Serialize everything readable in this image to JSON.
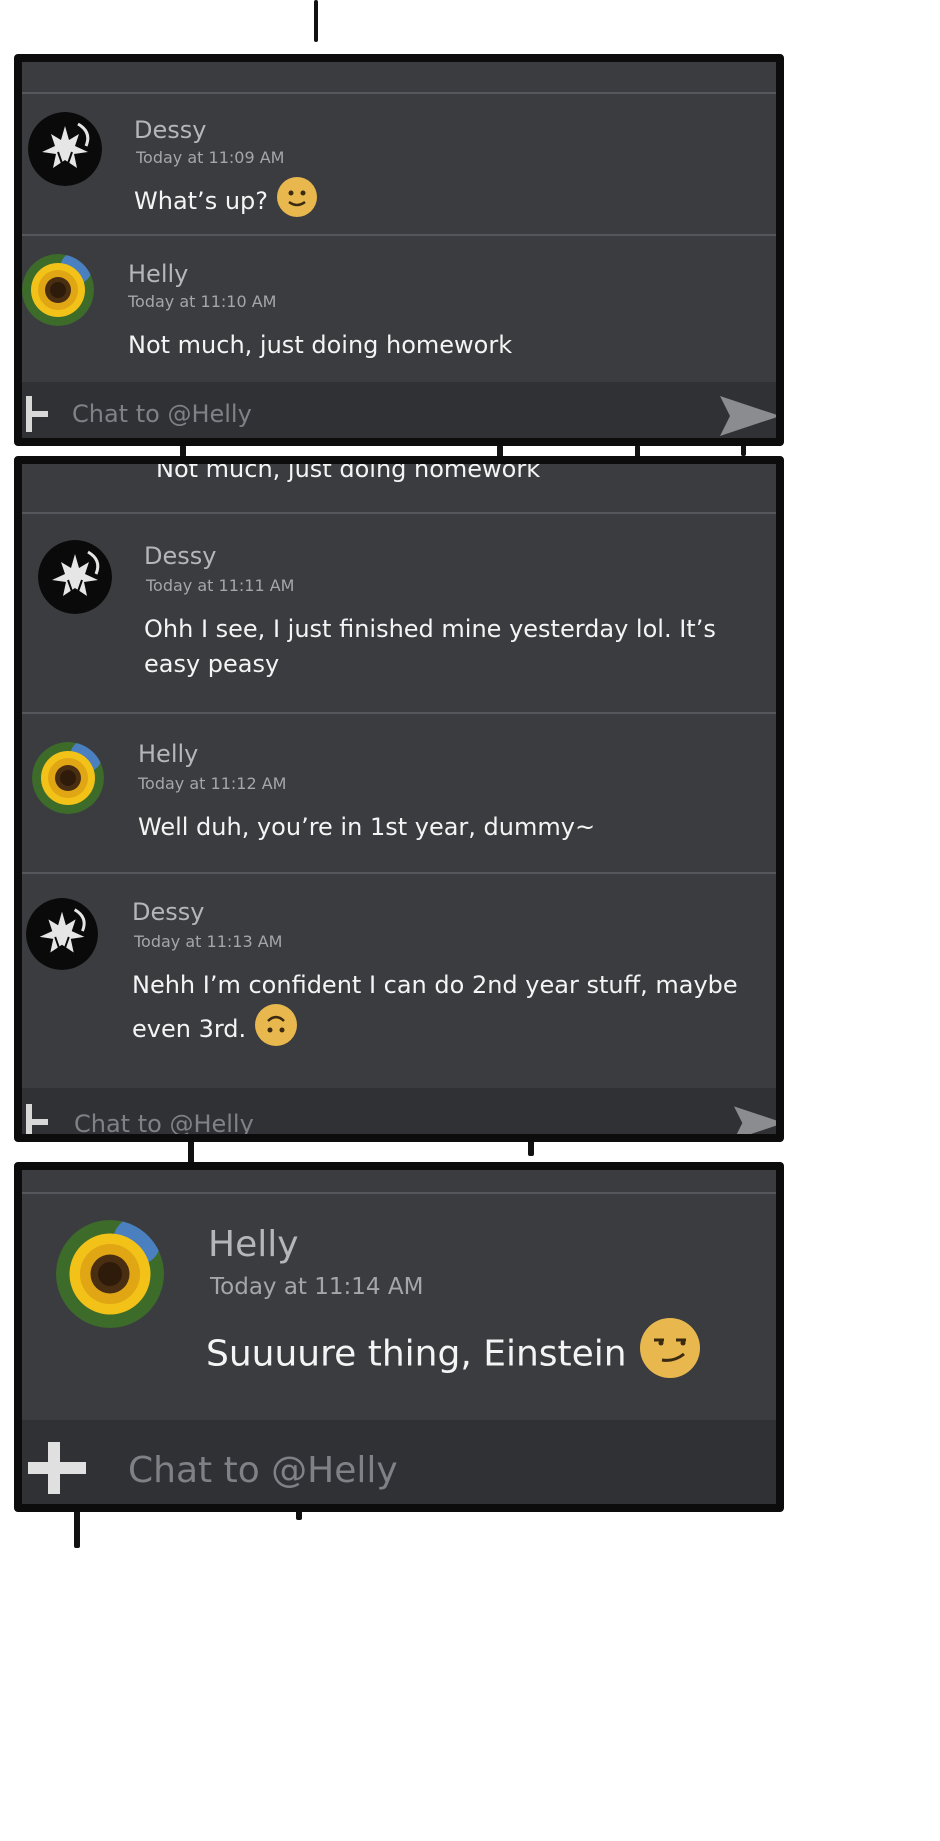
{
  "composer": {
    "placeholder": "Chat to @Helly"
  },
  "panel1": {
    "messages": [
      {
        "author": "Dessy",
        "time": "Today at 11:09 AM",
        "text": "What’s up?",
        "emoji": "slightly-smiling-face-icon"
      },
      {
        "author": "Helly",
        "time": "Today at 11:10 AM",
        "text": "Not much, just doing homework"
      }
    ]
  },
  "panel2": {
    "cut_text": "Not much, just doing homework",
    "messages": [
      {
        "author": "Dessy",
        "time": "Today at 11:11 AM",
        "text_line1": "Ohh I see, I just finished mine yesterday lol. It’s",
        "text_line2": "easy peasy"
      },
      {
        "author": "Helly",
        "time": "Today at 11:12 AM",
        "text": "Well duh, you’re in 1st year, dummy~"
      },
      {
        "author": "Dessy",
        "time": "Today at 11:13 AM",
        "text_line1": "Nehh I’m confident I can do 2nd year stuff, maybe",
        "text_line2": "even 3rd.",
        "emoji": "upside-down-face-icon"
      }
    ]
  },
  "panel3": {
    "messages": [
      {
        "author": "Helly",
        "time": "Today at 11:14 AM",
        "text": "Suuuure thing, Einstein",
        "emoji": "smirking-face-icon"
      }
    ]
  },
  "colors": {
    "panel_bg": "#3b3c40",
    "composer_bg": "#303135",
    "border": "#0c0c0c",
    "emoji_yellow": "#e8b84f"
  }
}
